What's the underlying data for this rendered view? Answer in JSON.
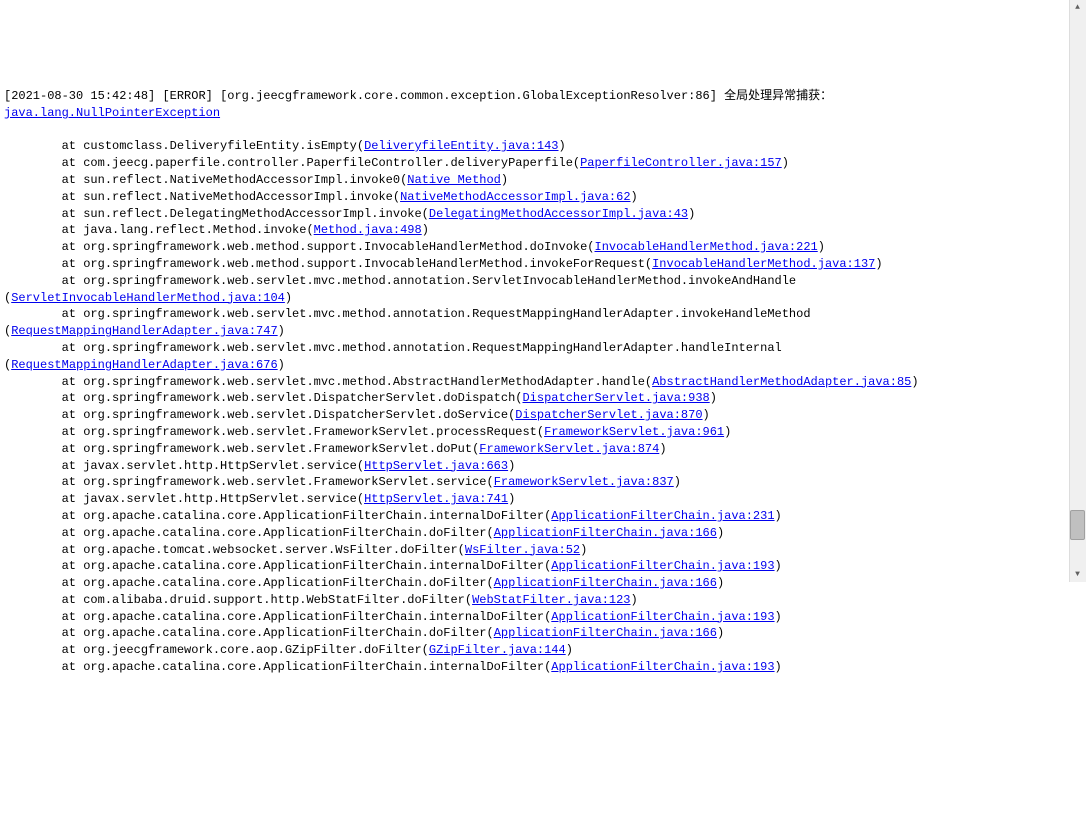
{
  "header": {
    "timestamp": "[2021-08-30 15:42:48]",
    "level": "[ERROR]",
    "source": "[org.jeecgframework.core.common.exception.GlobalExceptionResolver:86]",
    "message": "全局处理异常捕获："
  },
  "exception": "java.lang.NullPointerException",
  "lines": [
    {
      "pre": "        at customclass.DeliveryfileEntity.isEmpty(",
      "link": "DeliveryfileEntity.java:143",
      "post": ")"
    },
    {
      "pre": "        at com.jeecg.paperfile.controller.PaperfileController.deliveryPaperfile(",
      "link": "PaperfileController.java:157",
      "post": ")"
    },
    {
      "pre": "        at sun.reflect.NativeMethodAccessorImpl.invoke0(",
      "link": "Native Method",
      "post": ")"
    },
    {
      "pre": "        at sun.reflect.NativeMethodAccessorImpl.invoke(",
      "link": "NativeMethodAccessorImpl.java:62",
      "post": ")"
    },
    {
      "pre": "        at sun.reflect.DelegatingMethodAccessorImpl.invoke(",
      "link": "DelegatingMethodAccessorImpl.java:43",
      "post": ")"
    },
    {
      "pre": "        at java.lang.reflect.Method.invoke(",
      "link": "Method.java:498",
      "post": ")"
    },
    {
      "pre": "        at org.springframework.web.method.support.InvocableHandlerMethod.doInvoke(",
      "link": "InvocableHandlerMethod.java:221",
      "post": ")"
    },
    {
      "pre": "        at org.springframework.web.method.support.InvocableHandlerMethod.invokeForRequest(",
      "link": "InvocableHandlerMethod.java:137",
      "post": ")"
    },
    {
      "pre": "        at org.springframework.web.servlet.mvc.method.annotation.ServletInvocableHandlerMethod.invokeAndHandle\n(",
      "link": "ServletInvocableHandlerMethod.java:104",
      "post": ")"
    },
    {
      "pre": "        at org.springframework.web.servlet.mvc.method.annotation.RequestMappingHandlerAdapter.invokeHandleMethod\n(",
      "link": "RequestMappingHandlerAdapter.java:747",
      "post": ")"
    },
    {
      "pre": "        at org.springframework.web.servlet.mvc.method.annotation.RequestMappingHandlerAdapter.handleInternal\n(",
      "link": "RequestMappingHandlerAdapter.java:676",
      "post": ")"
    },
    {
      "pre": "        at org.springframework.web.servlet.mvc.method.AbstractHandlerMethodAdapter.handle(",
      "link": "AbstractHandlerMethodAdapter.java:85",
      "post": ")"
    },
    {
      "pre": "        at org.springframework.web.servlet.DispatcherServlet.doDispatch(",
      "link": "DispatcherServlet.java:938",
      "post": ")"
    },
    {
      "pre": "        at org.springframework.web.servlet.DispatcherServlet.doService(",
      "link": "DispatcherServlet.java:870",
      "post": ")"
    },
    {
      "pre": "        at org.springframework.web.servlet.FrameworkServlet.processRequest(",
      "link": "FrameworkServlet.java:961",
      "post": ")"
    },
    {
      "pre": "        at org.springframework.web.servlet.FrameworkServlet.doPut(",
      "link": "FrameworkServlet.java:874",
      "post": ")"
    },
    {
      "pre": "        at javax.servlet.http.HttpServlet.service(",
      "link": "HttpServlet.java:663",
      "post": ")"
    },
    {
      "pre": "        at org.springframework.web.servlet.FrameworkServlet.service(",
      "link": "FrameworkServlet.java:837",
      "post": ")"
    },
    {
      "pre": "        at javax.servlet.http.HttpServlet.service(",
      "link": "HttpServlet.java:741",
      "post": ")"
    },
    {
      "pre": "        at org.apache.catalina.core.ApplicationFilterChain.internalDoFilter(",
      "link": "ApplicationFilterChain.java:231",
      "post": ")"
    },
    {
      "pre": "        at org.apache.catalina.core.ApplicationFilterChain.doFilter(",
      "link": "ApplicationFilterChain.java:166",
      "post": ")"
    },
    {
      "pre": "        at org.apache.tomcat.websocket.server.WsFilter.doFilter(",
      "link": "WsFilter.java:52",
      "post": ")"
    },
    {
      "pre": "        at org.apache.catalina.core.ApplicationFilterChain.internalDoFilter(",
      "link": "ApplicationFilterChain.java:193",
      "post": ")"
    },
    {
      "pre": "        at org.apache.catalina.core.ApplicationFilterChain.doFilter(",
      "link": "ApplicationFilterChain.java:166",
      "post": ")"
    },
    {
      "pre": "        at com.alibaba.druid.support.http.WebStatFilter.doFilter(",
      "link": "WebStatFilter.java:123",
      "post": ")"
    },
    {
      "pre": "        at org.apache.catalina.core.ApplicationFilterChain.internalDoFilter(",
      "link": "ApplicationFilterChain.java:193",
      "post": ")"
    },
    {
      "pre": "        at org.apache.catalina.core.ApplicationFilterChain.doFilter(",
      "link": "ApplicationFilterChain.java:166",
      "post": ")"
    },
    {
      "pre": "        at org.jeecgframework.core.aop.GZipFilter.doFilter(",
      "link": "GZipFilter.java:144",
      "post": ")"
    },
    {
      "pre": "        at org.apache.catalina.core.ApplicationFilterChain.internalDoFilter(",
      "link": "ApplicationFilterChain.java:193",
      "post": ")"
    }
  ]
}
